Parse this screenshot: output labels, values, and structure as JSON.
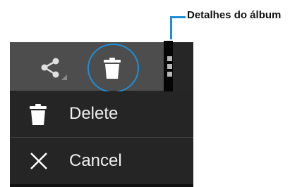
{
  "callout": {
    "label": "Detalhes do álbum",
    "color": "#1e8fd6"
  },
  "action_bar": {
    "share_icon": "share-icon",
    "delete_icon": "trash-icon",
    "overflow_icon": "overflow-menu-icon",
    "highlight_color": "#1e8fd6"
  },
  "menu": {
    "items": [
      {
        "label": "Delete",
        "icon": "trash-icon"
      },
      {
        "label": "Cancel",
        "icon": "close-icon"
      }
    ]
  }
}
